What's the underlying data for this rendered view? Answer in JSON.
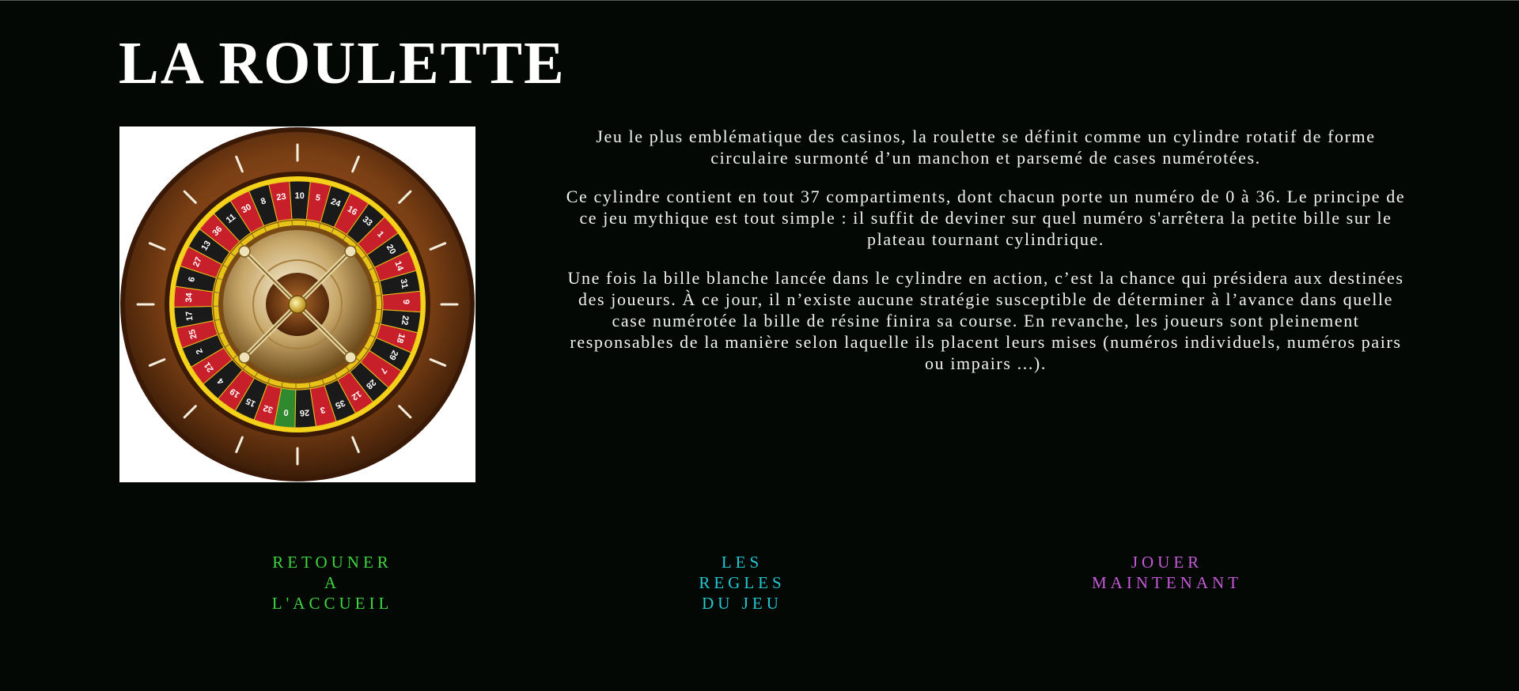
{
  "header": {
    "title": "LA ROULETTE"
  },
  "image": {
    "alt": "roulette-wheel",
    "pockets": [
      "0",
      "32",
      "15",
      "19",
      "4",
      "21",
      "2",
      "25",
      "17",
      "34",
      "6",
      "27",
      "13",
      "36",
      "11",
      "30",
      "8",
      "23",
      "10",
      "5",
      "24",
      "16",
      "33",
      "1",
      "20",
      "14",
      "31",
      "9",
      "22",
      "18",
      "29",
      "7",
      "28",
      "12",
      "35",
      "3",
      "26"
    ]
  },
  "description": {
    "paragraphs": [
      "Jeu le plus emblématique des casinos, la roulette se définit comme un cylindre rotatif de forme circulaire surmonté d’un manchon et parsemé de cases numérotées.",
      "Ce cylindre contient en tout 37 compartiments, dont chacun porte un numéro de 0 à 36. Le principe de ce jeu mythique est tout simple : il suffit de deviner sur quel numéro s'arrêtera la petite bille sur le plateau tournant cylindrique.",
      "Une fois la bille blanche lancée dans le cylindre en action, c’est la chance qui présidera aux destinées des joueurs. À ce jour, il n’existe aucune stratégie susceptible de déterminer à l’avance dans quelle case numérotée la bille de résine finira sa course. En revanche, les joueurs sont pleinement responsables de la manière selon laquelle ils placent leurs mises (numéros individuels, numéros pairs ou impairs ...)."
    ]
  },
  "nav": {
    "home": {
      "lines": [
        "RETOUNER",
        "A",
        "L'ACCUEIL"
      ],
      "color": "#3ed63e"
    },
    "rules": {
      "lines": [
        "LES",
        "REGLES",
        "DU JEU"
      ],
      "color": "#22c8d2"
    },
    "play": {
      "lines": [
        "JOUER",
        "MAINTENANT"
      ],
      "color": "#c65ad8"
    }
  },
  "colors": {
    "background": "#040805",
    "red_pocket": "#c8202a",
    "black_pocket": "#1a1a1a",
    "green_pocket": "#2f8a2f",
    "gold": "#e8c418",
    "wood": "#6b3a15"
  }
}
